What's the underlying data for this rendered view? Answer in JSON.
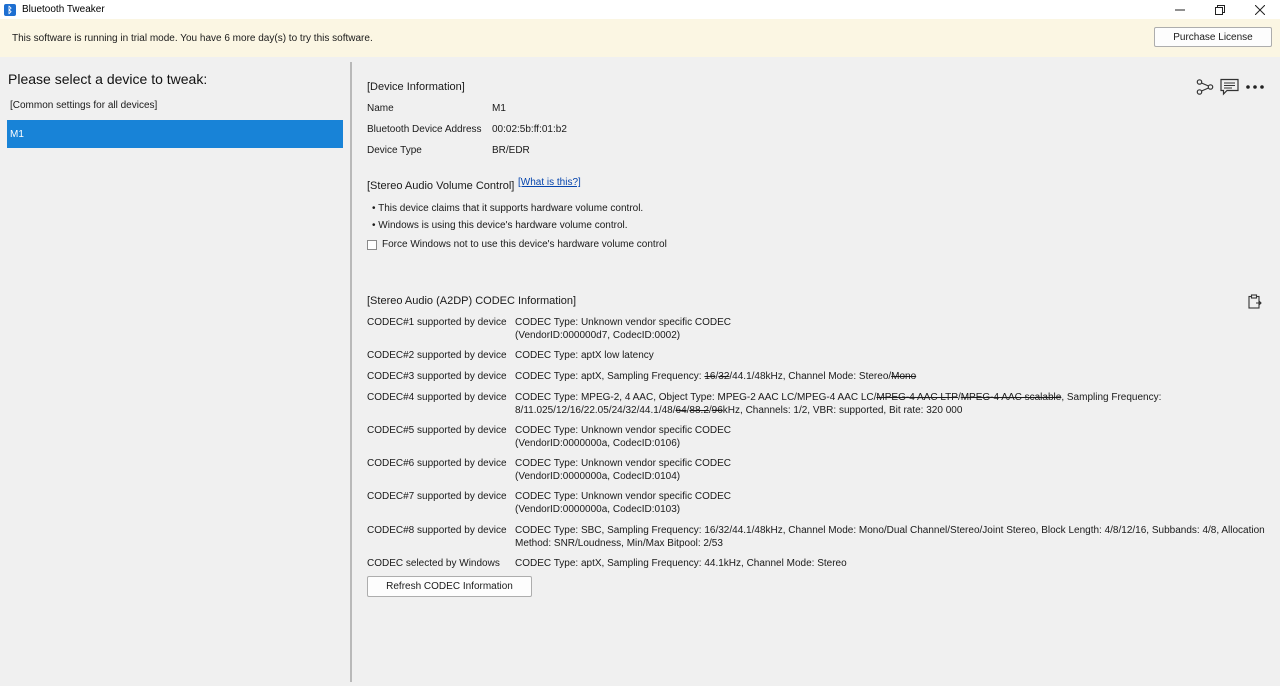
{
  "window": {
    "title": "Bluetooth Tweaker"
  },
  "trial": {
    "message": "This software is running in trial mode. You have 6 more day(s) to try this software.",
    "purchase_label": "Purchase License"
  },
  "left": {
    "heading": "Please select a device to tweak:",
    "common_item": "[Common settings for all devices]",
    "selected_device": "M1"
  },
  "device_info": {
    "title": "[Device Information]",
    "rows": [
      {
        "label": "Name",
        "value": "M1"
      },
      {
        "label": "Bluetooth Device Address",
        "value": "00:02:5b:ff:01:b2"
      },
      {
        "label": "Device Type",
        "value": "BR/EDR"
      }
    ]
  },
  "volume": {
    "title": "[Stereo Audio Volume Control]",
    "link": "[What is this?]",
    "bullet1": "• This device claims that it supports hardware volume control.",
    "bullet2": "• Windows is using this device's hardware volume control.",
    "checkbox_label": "Force Windows not to use this device's hardware volume control"
  },
  "codec": {
    "title": "[Stereo Audio (A2DP) CODEC Information]",
    "rows": [
      {
        "label": "CODEC#1 supported by device",
        "line1": "CODEC Type: Unknown vendor specific CODEC",
        "line2": "(VendorID:000000d7, CodecID:0002)"
      },
      {
        "label": "CODEC#2 supported by device",
        "line1": "CODEC Type: aptX low latency"
      },
      {
        "label": "CODEC#3 supported by device",
        "p1": "CODEC Type: aptX, Sampling Frequency: ",
        "s1": "16",
        "p2": "/",
        "s2": "32",
        "p3": "/44.1/48kHz, Channel Mode: Stereo/",
        "s3": "Mono"
      },
      {
        "label": "CODEC#4 supported by device",
        "p1": "CODEC Type: MPEG-2, 4 AAC, Object Type: MPEG-2 AAC LC/MPEG-4 AAC LC/",
        "s1": "MPEG-4 AAC LTP",
        "p2": "/",
        "s2": "MPEG-4 AAC scalable",
        "p3": ", Sampling Frequency:",
        "p4": "8/11.025/12/16/22.05/24/32/44.1/48/",
        "s3": "64",
        "p5": "/",
        "s4": "88.2",
        "p6": "/",
        "s5": "96",
        "p7": "kHz, Channels: 1/2, VBR: supported, Bit rate: 320 000"
      },
      {
        "label": "CODEC#5 supported by device",
        "line1": "CODEC Type: Unknown vendor specific CODEC",
        "line2": "(VendorID:0000000a, CodecID:0106)"
      },
      {
        "label": "CODEC#6 supported by device",
        "line1": "CODEC Type: Unknown vendor specific CODEC",
        "line2": "(VendorID:0000000a, CodecID:0104)"
      },
      {
        "label": "CODEC#7 supported by device",
        "line1": "CODEC Type: Unknown vendor specific CODEC",
        "line2": "(VendorID:0000000a, CodecID:0103)"
      },
      {
        "label": "CODEC#8 supported by device",
        "line1": "CODEC Type: SBC, Sampling Frequency: 16/32/44.1/48kHz, Channel Mode: Mono/Dual Channel/Stereo/Joint Stereo, Block Length: 4/8/12/16, Subbands: 4/8, Allocation",
        "line2": "Method: SNR/Loudness, Min/Max Bitpool: 2/53"
      },
      {
        "label": "CODEC selected by Windows",
        "line1": "CODEC Type: aptX, Sampling Frequency: 44.1kHz, Channel Mode: Stereo"
      }
    ],
    "refresh_label": "Refresh CODEC Information"
  },
  "icons": {
    "app": "bluetooth-icon",
    "share": "share-icon",
    "feedback": "comment-icon",
    "more": "more-icon",
    "copy": "clipboard-icon"
  },
  "colors": {
    "selection": "#1883d7",
    "trial_bg": "#fbf6e3",
    "link": "#0645ad"
  }
}
